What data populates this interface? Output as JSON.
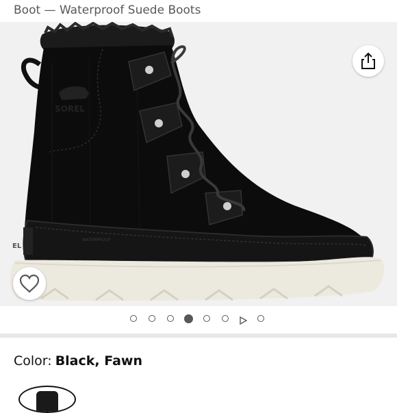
{
  "product": {
    "title_line": "Boot — Waterproof Suede Boots",
    "color_label": "Color:",
    "color_value": "Black, Fawn"
  },
  "gallery": {
    "image_description": "boot-product-photo",
    "total_items": 7,
    "active_index": 3,
    "video_index": 5,
    "share_icon": "share-icon",
    "wishlist_icon": "heart-outline-icon",
    "background_color": "#f1f1f1"
  },
  "colors": {
    "text_primary": "#0f1111",
    "text_secondary": "#565959",
    "divider": "#e7e7e7"
  }
}
